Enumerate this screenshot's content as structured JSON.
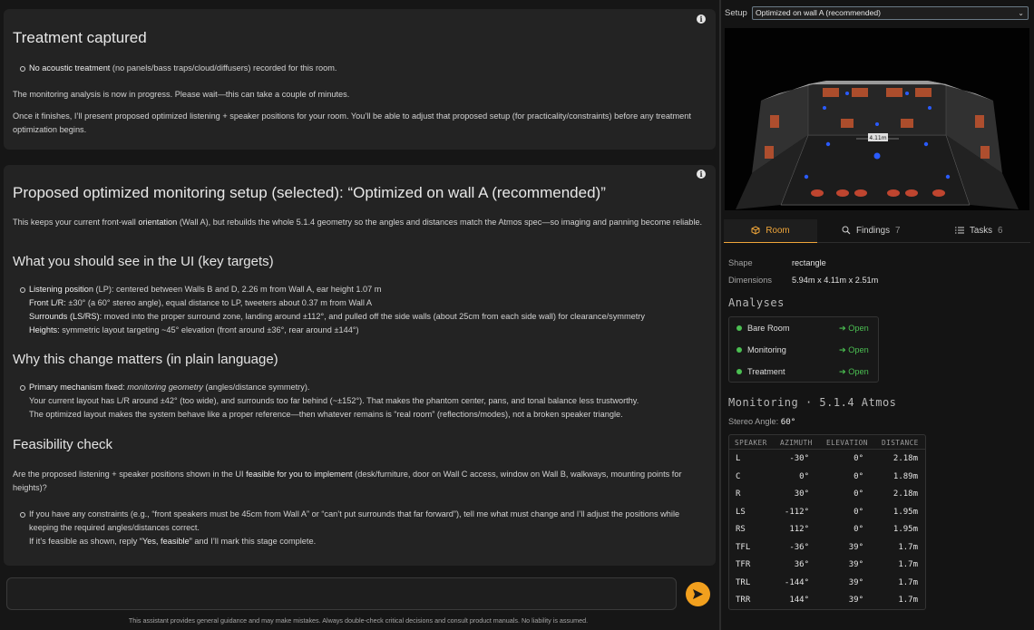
{
  "card1": {
    "title": "Treatment captured",
    "bullet1": {
      "bold": "No acoustic treatment",
      "text": " (no panels/bass traps/cloud/diffusers) recorded for this room."
    },
    "para1": "The monitoring analysis is now in progress. Please wait—this can take a couple of minutes.",
    "para2": "Once it finishes, I’ll present proposed optimized listening + speaker positions for your room. You’ll be able to adjust that proposed setup (for practicality/constraints) before any treatment optimization begins."
  },
  "card2": {
    "title": "Proposed optimized monitoring setup (selected): “Optimized on wall A (recommended)”",
    "intro_a": "This keeps your current front-wall ",
    "intro_b": "orientation",
    "intro_c": " (Wall A), but rebuilds the whole 5.1.4 geometry so the angles and distances match the Atmos spec—so imaging and panning become reliable.",
    "section1": "What you should see in the UI (key targets)",
    "targets": [
      {
        "bold": "Listening position",
        "text": " (LP): centered between Walls B and D, 2.26 m from Wall A, ear height 1.07 m"
      },
      {
        "bold": "Front L/R:",
        "text": " ±30° (a 60° stereo angle), equal distance to LP, tweeters about 0.37 m from Wall A"
      },
      {
        "bold": "Surrounds (LS/RS):",
        "text": " moved into the proper surround zone, landing around ±112°, and pulled off the side walls (about 25cm from each side wall) for clearance/symmetry"
      },
      {
        "bold": "Heights:",
        "text": " symmetric layout targeting ~45° elevation (front around ±36°, rear around ±144°)"
      }
    ],
    "section2": "Why this change matters (in plain language)",
    "why1_a": "Primary mechanism fixed: ",
    "why1_b": "monitoring geometry",
    "why1_c": " (angles/distance symmetry).",
    "why2": "Your current layout has L/R around ±42° (too wide), and surrounds too far behind (~±152°). That makes the phantom center, pans, and tonal balance less trustworthy.",
    "why3": "The optimized layout makes the system behave like a proper reference—then whatever remains is “real room” (reflections/modes), not a broken speaker triangle.",
    "section3": "Feasibility check",
    "feas_a": "Are the proposed listening + speaker positions shown in the UI ",
    "feas_b": "feasible for you to implement",
    "feas_c": " (desk/furniture, door on Wall C access, window on Wall B, walkways, mounting points for heights)?",
    "feas_li1": "If you have any constraints (e.g., “front speakers must be 45cm from Wall A” or “can’t put surrounds that far forward”), tell me what must change and I’ll adjust the positions while keeping the required angles/distances correct.",
    "feas_li2_a": "If it’s feasible as shown, reply ",
    "feas_li2_b": "“Yes, feasible”",
    "feas_li2_c": " and I’ll mark this stage complete."
  },
  "composer": {
    "placeholder": ""
  },
  "disclaimer": "This assistant provides general guidance and may make mistakes. Always double-check critical decisions and consult product manuals. No liability is assumed.",
  "right": {
    "setup_label": "Setup",
    "setup_value": "Optimized on wall A (recommended)",
    "viewport_label": "4.11m",
    "tabs": [
      {
        "label": "Room",
        "count": ""
      },
      {
        "label": "Findings",
        "count": "7"
      },
      {
        "label": "Tasks",
        "count": "6"
      }
    ],
    "shape_key": "Shape",
    "shape_val": "rectangle",
    "dim_key": "Dimensions",
    "dim_val": "5.94m x 4.11m x 2.51m",
    "analyses_title": "Analyses",
    "analyses": [
      {
        "label": "Bare Room",
        "action": "Open"
      },
      {
        "label": "Monitoring",
        "action": "Open"
      },
      {
        "label": "Treatment",
        "action": "Open"
      }
    ],
    "monitoring_title": "Monitoring · 5.1.4 Atmos",
    "stereo_label": "Stereo Angle:",
    "stereo_value": "60°",
    "table_headers": [
      "SPEAKER",
      "AZIMUTH",
      "ELEVATION",
      "DISTANCE"
    ],
    "speakers": [
      {
        "name": "L",
        "az": "-30°",
        "el": "0°",
        "dist": "2.18m"
      },
      {
        "name": "C",
        "az": "0°",
        "el": "0°",
        "dist": "1.89m"
      },
      {
        "name": "R",
        "az": "30°",
        "el": "0°",
        "dist": "2.18m"
      },
      {
        "name": "LS",
        "az": "-112°",
        "el": "0°",
        "dist": "1.95m"
      },
      {
        "name": "RS",
        "az": "112°",
        "el": "0°",
        "dist": "1.95m"
      },
      {
        "name": "TFL",
        "az": "-36°",
        "el": "39°",
        "dist": "1.7m"
      },
      {
        "name": "TFR",
        "az": "36°",
        "el": "39°",
        "dist": "1.7m"
      },
      {
        "name": "TRL",
        "az": "-144°",
        "el": "39°",
        "dist": "1.7m"
      },
      {
        "name": "TRR",
        "az": "144°",
        "el": "39°",
        "dist": "1.7m"
      }
    ]
  }
}
